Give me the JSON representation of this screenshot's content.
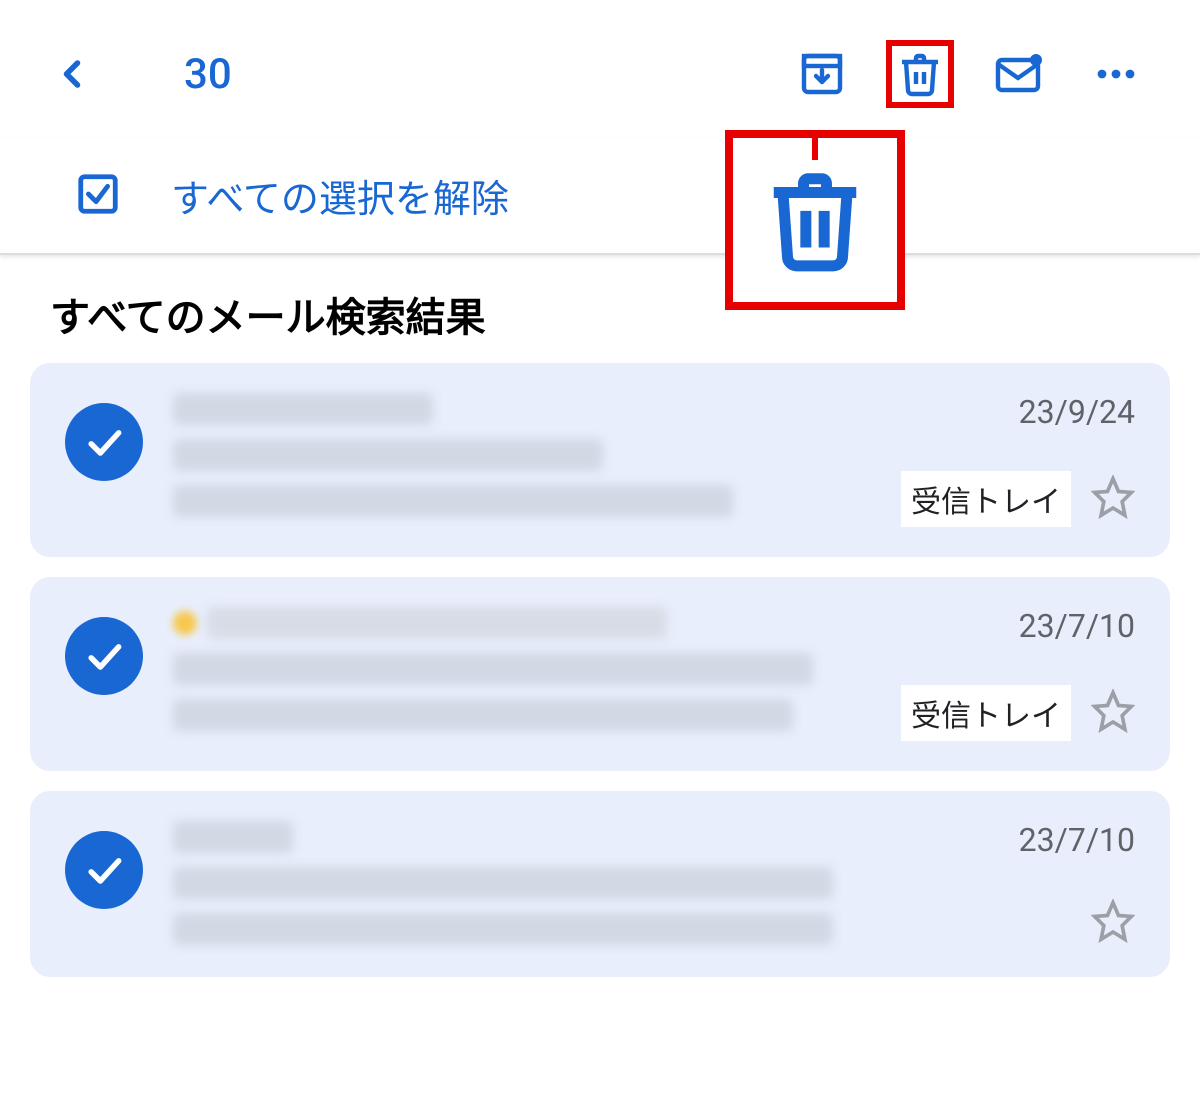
{
  "toolbar": {
    "selected_count": "30"
  },
  "select_row": {
    "deselect_label": "すべての選択を解除"
  },
  "section_title": "すべてのメール検索結果",
  "labels": {
    "inbox": "受信トレイ"
  },
  "mails": [
    {
      "date": "23/9/24",
      "label_key": "inbox",
      "show_label": true
    },
    {
      "date": "23/7/10",
      "label_key": "inbox",
      "show_label": true
    },
    {
      "date": "23/7/10",
      "label_key": "inbox",
      "show_label": false
    }
  ]
}
